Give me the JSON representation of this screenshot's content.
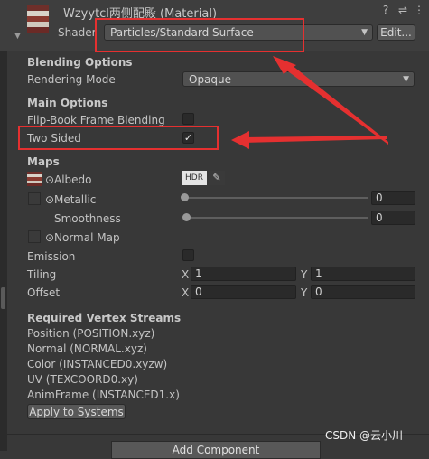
{
  "header": {
    "title": "Wzyytcl两侧配殿 (Material)",
    "shader_label": "Shader",
    "shader_value": "Particles/Standard Surface",
    "edit_button": "Edit..."
  },
  "blending": {
    "heading": "Blending Options",
    "rendering_mode_label": "Rendering Mode",
    "rendering_mode_value": "Opaque"
  },
  "main_options": {
    "heading": "Main Options",
    "flipbook_label": "Flip-Book Frame Blending",
    "two_sided_label": "Two Sided",
    "two_sided_check": "✓"
  },
  "maps": {
    "heading": "Maps",
    "albedo_label": "Albedo",
    "hdr_label": "HDR",
    "metallic_label": "Metallic",
    "metallic_value": "0",
    "smoothness_label": "Smoothness",
    "smoothness_value": "0",
    "normal_map_label": "Normal Map",
    "emission_label": "Emission",
    "tiling_label": "Tiling",
    "tiling_x": "1",
    "tiling_y": "1",
    "offset_label": "Offset",
    "offset_x": "0",
    "offset_y": "0",
    "x_label": "X",
    "y_label": "Y"
  },
  "vertex_streams": {
    "heading": "Required Vertex Streams",
    "items": [
      "Position (POSITION.xyz)",
      "Normal (NORMAL.xyz)",
      "Color (INSTANCED0.xyzw)",
      "UV (TEXCOORD0.xy)",
      "AnimFrame (INSTANCED1.x)"
    ],
    "apply_button": "Apply to Systems"
  },
  "footer": {
    "add_component_button": "Add Component"
  },
  "watermark": "CSDN @云小川",
  "colors": {
    "annotation_red": "#e53030",
    "panel_bg": "#383838"
  }
}
